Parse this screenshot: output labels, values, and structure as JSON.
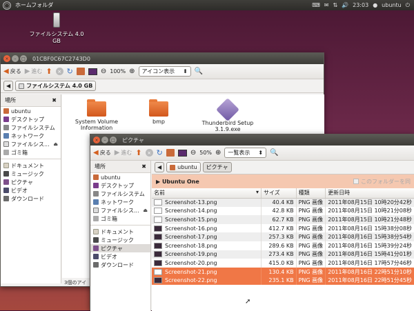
{
  "topbar": {
    "title": "ホームフォルダ",
    "time": "23:03",
    "user": "ubuntu"
  },
  "desktop_icon": {
    "label": "ファイルシステム 4.0 GB"
  },
  "win1": {
    "title": "01CBF0C67C2743D0",
    "back": "戻る",
    "forward": "進む",
    "zoom": "100%",
    "view": "アイコン表示",
    "crumb": "ファイルシステム 4.0 GB",
    "side_head": "場所",
    "places": [
      {
        "label": "ubuntu",
        "icon": "home"
      },
      {
        "label": "デスクトップ",
        "icon": "desk"
      },
      {
        "label": "ファイルシステム",
        "icon": "fs"
      },
      {
        "label": "ネットワーク",
        "icon": "net"
      },
      {
        "label": "ファイルシス...",
        "icon": "usb"
      },
      {
        "label": "ゴミ箱",
        "icon": "trash"
      }
    ],
    "bookmarks": [
      {
        "label": "ドキュメント",
        "icon": "doc"
      },
      {
        "label": "ミュージック",
        "icon": "music"
      },
      {
        "label": "ピクチャ",
        "icon": "pic"
      },
      {
        "label": "ビデオ",
        "icon": "vid"
      },
      {
        "label": "ダウンロード",
        "icon": "dl"
      }
    ],
    "items": [
      {
        "label": "System Volume\nInformation"
      },
      {
        "label": "bmp"
      },
      {
        "label": "Thunderbird Setup\n3.1.9.exe"
      }
    ],
    "status": "3個のアイ"
  },
  "win2": {
    "title": "ピクチャ",
    "back": "戻る",
    "forward": "進む",
    "zoom": "50%",
    "view": "一覧表示",
    "crumbs": [
      "ubuntu",
      "ピクチャ"
    ],
    "side_head": "場所",
    "places": [
      {
        "label": "ubuntu",
        "icon": "home"
      },
      {
        "label": "デスクトップ",
        "icon": "desk"
      },
      {
        "label": "ファイルシステム",
        "icon": "fs"
      },
      {
        "label": "ネットワーク",
        "icon": "net"
      },
      {
        "label": "ファイルシス...",
        "icon": "usb"
      },
      {
        "label": "ゴミ箱",
        "icon": "trash"
      }
    ],
    "bookmarks": [
      {
        "label": "ドキュメント",
        "icon": "doc"
      },
      {
        "label": "ミュージック",
        "icon": "music"
      },
      {
        "label": "ピクチャ",
        "icon": "pic",
        "selected": true
      },
      {
        "label": "ビデオ",
        "icon": "vid"
      },
      {
        "label": "ダウンロード",
        "icon": "dl"
      }
    ],
    "banner": {
      "title": "Ubuntu One",
      "check": "このフォルダーを同"
    },
    "columns": [
      "名前",
      "サイズ",
      "種類",
      "更新日時"
    ],
    "rows": [
      {
        "name": "Screenshot-13.png",
        "size": "40.4 KB",
        "type": "PNG 画像",
        "date": "2011年08月15日 10時20分42秒",
        "thumb": "light"
      },
      {
        "name": "Screenshot-14.png",
        "size": "42.8 KB",
        "type": "PNG 画像",
        "date": "2011年08月15日 10時21分08秒",
        "thumb": "light"
      },
      {
        "name": "Screenshot-15.png",
        "size": "62.7 KB",
        "type": "PNG 画像",
        "date": "2011年08月15日 10時21分48秒",
        "thumb": "light"
      },
      {
        "name": "Screenshot-16.png",
        "size": "412.7 KB",
        "type": "PNG 画像",
        "date": "2011年08月16日 15時38分08秒",
        "thumb": "dark"
      },
      {
        "name": "Screenshot-17.png",
        "size": "257.3 KB",
        "type": "PNG 画像",
        "date": "2011年08月16日 15時38分54秒",
        "thumb": "dark"
      },
      {
        "name": "Screenshot-18.png",
        "size": "289.6 KB",
        "type": "PNG 画像",
        "date": "2011年08月16日 15時39分24秒",
        "thumb": "dark"
      },
      {
        "name": "Screenshot-19.png",
        "size": "273.4 KB",
        "type": "PNG 画像",
        "date": "2011年08月16日 15時41分01秒",
        "thumb": "dark"
      },
      {
        "name": "Screenshot-20.png",
        "size": "415.0 KB",
        "type": "PNG 画像",
        "date": "2011年08月16日 17時57分46秒",
        "thumb": "dark"
      },
      {
        "name": "Screenshot-21.png",
        "size": "130.4 KB",
        "type": "PNG 画像",
        "date": "2011年08月16日 22時51分10秒",
        "thumb": "light",
        "selected": true
      },
      {
        "name": "Screenshot-22.png",
        "size": "235.1 KB",
        "type": "PNG 画像",
        "date": "2011年08月16日 22時51分45秒",
        "thumb": "dark",
        "selected": true
      }
    ]
  }
}
